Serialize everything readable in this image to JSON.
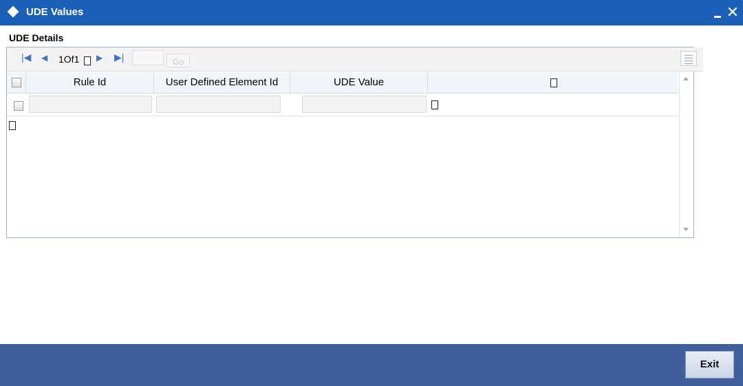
{
  "window": {
    "title": "UDE Values",
    "minimize_icon": "minimize-icon",
    "close_icon": "close-x-icon"
  },
  "section": {
    "title": "UDE Details"
  },
  "pagination": {
    "current_page": "1",
    "of_label": "Of",
    "total_pages": "1",
    "go_label": "Go",
    "page_input_value": ""
  },
  "table": {
    "columns": [
      "Rule Id",
      "User Defined Element Id",
      "UDE Value"
    ],
    "rows": [
      {
        "rule_id": "",
        "user_defined_element_id": "",
        "ude_value": ""
      }
    ]
  },
  "footer": {
    "exit_label": "Exit"
  },
  "colors": {
    "titlebar": "#1a60b8",
    "footer": "#41609b",
    "header_row": "#f1f4f8"
  }
}
